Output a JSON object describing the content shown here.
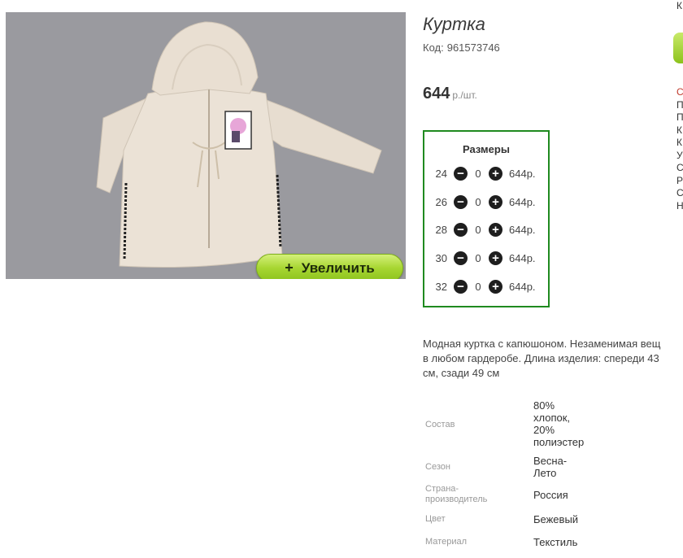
{
  "product": {
    "title": "Куртка",
    "code_label": "Код:",
    "code_value": "961573746",
    "price": "644",
    "price_unit": "р./шт."
  },
  "gallery": {
    "zoom_label": "Увеличить",
    "zoom_icon": "+"
  },
  "sizes": {
    "title": "Размеры",
    "rows": [
      {
        "size": "24",
        "qty": "0",
        "price": "644р."
      },
      {
        "size": "26",
        "qty": "0",
        "price": "644р."
      },
      {
        "size": "28",
        "qty": "0",
        "price": "644р."
      },
      {
        "size": "30",
        "qty": "0",
        "price": "644р."
      },
      {
        "size": "32",
        "qty": "0",
        "price": "644р."
      }
    ],
    "minus_icon": "minus-circle-icon",
    "plus_icon": "plus-circle-icon"
  },
  "description": {
    "lines": [
      "Модная куртка с капюшоном. Незаменимая вещ",
      "в любом гардеробе. Длина изделия: спереди 43",
      "см, сзади 49 см"
    ]
  },
  "properties": [
    {
      "label": "Состав",
      "value_lines": [
        "80%",
        "хлопок,",
        "20%",
        "полиэстер"
      ]
    },
    {
      "label": "Сезон",
      "value_lines": [
        "Весна-",
        "Лето"
      ]
    },
    {
      "label_lines": [
        "Страна-",
        "производитель"
      ],
      "value_lines": [
        "Россия"
      ]
    },
    {
      "label": "Цвет",
      "value_lines": [
        "Бежевый"
      ]
    },
    {
      "label": "Материал",
      "value_lines": [
        "Текстиль"
      ]
    }
  ],
  "right_edge": {
    "top_letter": "К",
    "list": [
      "С",
      "П",
      "П",
      "К",
      "К",
      "У",
      "С",
      "Р",
      "С",
      "Н"
    ]
  },
  "colors": {
    "sizes_border": "#1f8a1f",
    "zoom_button": "#a7d632",
    "photo_background": "#9a9a9f"
  }
}
